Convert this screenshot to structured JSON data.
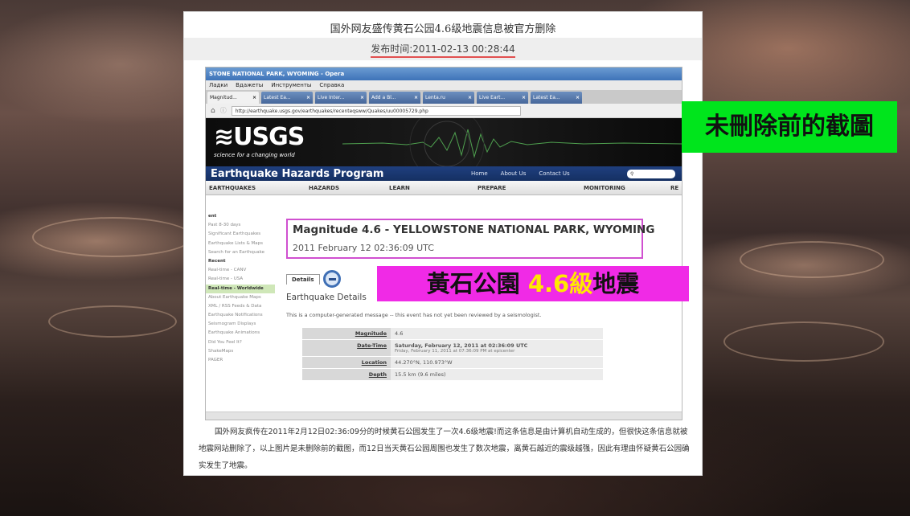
{
  "article": {
    "title": "国外网友盛传黄石公园4.6级地震信息被官方删除",
    "date": "发布时间:2011-02-13 00:28:44",
    "body": "国外网友疯传在2011年2月12日02:36:09分的时候黄石公园发生了一次4.6级地震!而这条信息是由计算机自动生成的，但很快这条信息就被地震网站删除了，以上图片是未删除前的截图，而12日当天黄石公园周围也发生了数次地震，离黄石越近的震级越强，因此有理由怀疑黄石公园确实发生了地震。"
  },
  "captions": {
    "before_delete": "未刪除前的截圖",
    "quake_prefix": "黃石公園 ",
    "quake_mag": "4.6級",
    "quake_suffix": "地震"
  },
  "browser": {
    "window_title": "STONE NATIONAL PARK, WYOMING - Opera",
    "menu": [
      "Ладки",
      "Вдажеты",
      "Инструменты",
      "Справка"
    ],
    "tabs": [
      "Magnitud...",
      "Latest Ea...",
      "Live Inter...",
      "Add a Bl...",
      "Lenta.ru",
      "Live Eart...",
      "Latest Ea..."
    ],
    "url": "http://earthquake.usgs.gov/earthquakes/recenteqsww/Quakes/uu00005729.php"
  },
  "site": {
    "logo": "≋USGS",
    "tagline": "science for a changing world",
    "program": "Earthquake Hazards Program",
    "links": [
      "Home",
      "About Us",
      "Contact Us"
    ],
    "nav": [
      "EARTHQUAKES",
      "HAZARDS",
      "LEARN",
      "PREPARE",
      "MONITORING",
      "RE"
    ],
    "sidebar": [
      {
        "label": "ent",
        "kind": "hd"
      },
      {
        "label": "Past 8-30 days",
        "kind": ""
      },
      {
        "label": "Significant Earthquakes",
        "kind": ""
      },
      {
        "label": "Earthquake Lists & Maps",
        "kind": ""
      },
      {
        "label": "Search for an Earthquake",
        "kind": ""
      },
      {
        "label": "Recent",
        "kind": "hd"
      },
      {
        "label": "Real-time - CANV",
        "kind": ""
      },
      {
        "label": "Real-time - USA",
        "kind": ""
      },
      {
        "label": "Real-time - Worldwide",
        "kind": "sel"
      },
      {
        "label": "About Earthquake Maps",
        "kind": ""
      },
      {
        "label": "XML / RSS Feeds & Data",
        "kind": ""
      },
      {
        "label": "Earthquake Notifications",
        "kind": ""
      },
      {
        "label": "Seismogram Displays",
        "kind": ""
      },
      {
        "label": "Earthquake Animations",
        "kind": ""
      },
      {
        "label": "Did You Feel It?",
        "kind": ""
      },
      {
        "label": "ShakeMaps",
        "kind": ""
      },
      {
        "label": "PAGER",
        "kind": ""
      }
    ],
    "quake_title": "Magnitude 4.6 - YELLOWSTONE NATIONAL PARK, WYOMING",
    "quake_time": "2011 February 12 02:36:09 UTC",
    "details_tab": "Details",
    "details_heading": "Earthquake Details",
    "notice": "This is a computer-generated message -- this event has not yet been reviewed by a seismologist.",
    "details": [
      {
        "k": "Magnitude",
        "v": "4.6",
        "sub": ""
      },
      {
        "k": "Date-Time",
        "v": "Saturday, February 12, 2011 at 02:36:09 UTC",
        "sub": "Friday, February 11, 2011 at 07:36:09 PM at epicenter"
      },
      {
        "k": "Location",
        "v": "44.270°N, 110.973°W",
        "sub": ""
      },
      {
        "k": "Depth",
        "v": "15.5 km (9.6 miles)",
        "sub": ""
      }
    ]
  }
}
